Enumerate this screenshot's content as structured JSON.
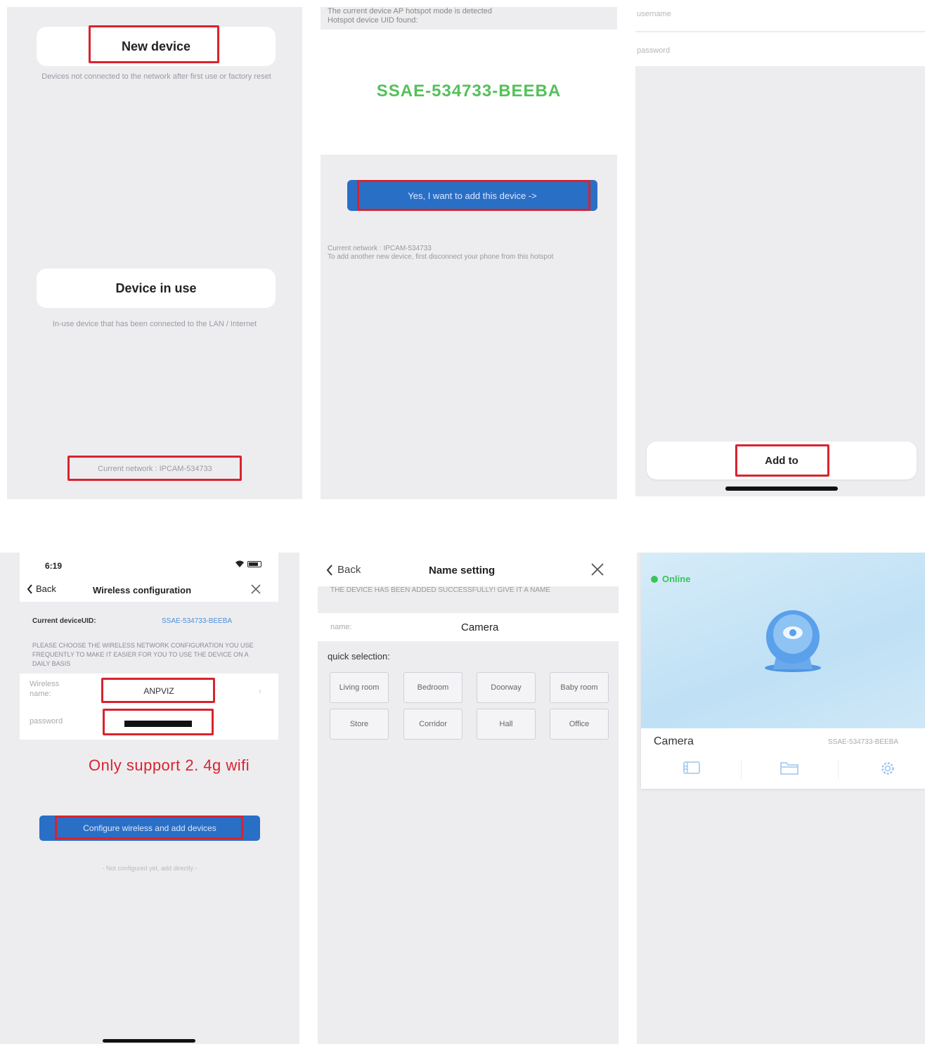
{
  "panel1": {
    "new_device_label": "New device",
    "new_device_desc": "Devices not connected to the network after first use or factory reset",
    "device_in_use_label": "Device in use",
    "device_in_use_desc": "In-use device that has been connected to the LAN / Internet",
    "current_network": "Current network : IPCAM-534733"
  },
  "panel2": {
    "header_line1": "The current device AP hotspot mode is detected",
    "header_line2": "Hotspot device UID found:",
    "uid": "SSAE-534733-BEEBA",
    "add_button_label": "Yes, I want to add this device ->",
    "network_line1": "Current network : IPCAM-534733",
    "network_line2": "To add another new device, first disconnect your phone from this hotspot",
    "uid_color": "#55c05a"
  },
  "panel3": {
    "username_placeholder": "username",
    "password_placeholder": "password",
    "add_to_label": "Add to"
  },
  "panel4": {
    "time": "6:19",
    "back_label": "Back",
    "title": "Wireless configuration",
    "current_uid_label": "Current deviceUID:",
    "current_uid_value": "SSAE-534733-BEEBA",
    "instructions": "PLEASE CHOOSE THE WIRELESS NETWORK CONFIGURATION YOU USE FREQUENTLY TO MAKE IT EASIER FOR YOU TO USE THE DEVICE ON A DAILY BASIS",
    "wireless_name_label": "Wireless name:",
    "wireless_name_value": "ANPVIZ",
    "password_label": "password",
    "support_note": "Only support 2. 4g wifi",
    "configure_button_label": "Configure wireless and add devices",
    "not_configured_link": "- Not configured yet, add directly -"
  },
  "panel5": {
    "back_label": "Back",
    "title": "Name setting",
    "success_message": "THE DEVICE HAS BEEN ADDED SUCCESSFULLY! GIVE IT A NAME",
    "name_label": "name:",
    "name_value": "Camera",
    "quick_selection_label": "quick selection:",
    "chips": [
      "Living room",
      "Bedroom",
      "Doorway",
      "Baby room",
      "Store",
      "Corridor",
      "Hall",
      "Office"
    ]
  },
  "panel6": {
    "status": "Online",
    "status_color": "#3cc25b",
    "device_name": "Camera",
    "device_uid": "SSAE-534733-BEEBA"
  },
  "colors": {
    "highlight_red": "#d9232e",
    "primary_blue": "#2a6fc6",
    "note_red": "#d9232e"
  }
}
